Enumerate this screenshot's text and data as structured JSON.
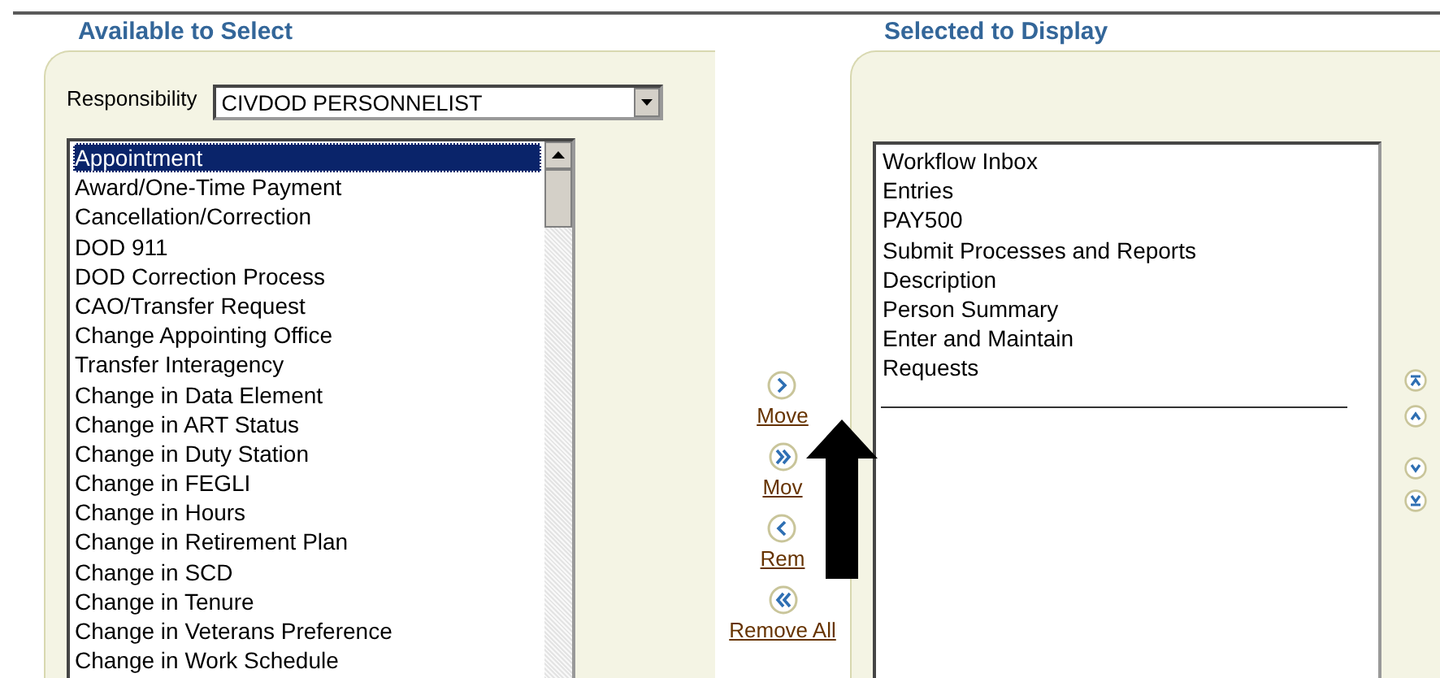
{
  "available": {
    "title": "Available to Select",
    "responsibility": {
      "label": "Responsibility",
      "value": "CIVDOD PERSONNELIST"
    },
    "items": [
      {
        "label": "Appointment",
        "selected": true
      },
      {
        "label": "Award/One-Time Payment",
        "selected": false
      },
      {
        "label": "Cancellation/Correction",
        "selected": false
      },
      {
        "label": "DOD 911",
        "selected": false
      },
      {
        "label": "DOD Correction Process",
        "selected": false
      },
      {
        "label": "CAO/Transfer Request",
        "selected": false
      },
      {
        "label": "Change Appointing Office",
        "selected": false
      },
      {
        "label": "Transfer Interagency",
        "selected": false
      },
      {
        "label": "Change in Data Element",
        "selected": false
      },
      {
        "label": "Change in ART Status",
        "selected": false
      },
      {
        "label": "Change in Duty Station",
        "selected": false
      },
      {
        "label": "Change in FEGLI",
        "selected": false
      },
      {
        "label": "Change in Hours",
        "selected": false
      },
      {
        "label": "Change in Retirement Plan",
        "selected": false
      },
      {
        "label": "Change in SCD",
        "selected": false
      },
      {
        "label": "Change in Tenure",
        "selected": false
      },
      {
        "label": "Change in Veterans Preference",
        "selected": false
      },
      {
        "label": "Change in Work Schedule",
        "selected": false
      }
    ]
  },
  "actions": [
    {
      "kind": "move",
      "label": "Move"
    },
    {
      "kind": "move_all",
      "label": "Mov"
    },
    {
      "kind": "remove",
      "label": "Rem"
    },
    {
      "kind": "remove_all",
      "label": "Remove All"
    }
  ],
  "selected": {
    "title": "Selected to Display",
    "items": [
      {
        "label": "Workflow Inbox",
        "selected": false
      },
      {
        "label": "Entries",
        "selected": false
      },
      {
        "label": "PAY500",
        "selected": false
      },
      {
        "label": "Submit Processes and Reports",
        "selected": false
      },
      {
        "label": "Description",
        "selected": false
      },
      {
        "label": "Person Summary",
        "selected": false
      },
      {
        "label": "Enter and Maintain",
        "selected": false
      },
      {
        "label": "Requests",
        "selected": false
      }
    ],
    "order_buttons": [
      {
        "kind": "top"
      },
      {
        "kind": "up"
      },
      {
        "kind": "down"
      },
      {
        "kind": "bottom"
      }
    ]
  }
}
